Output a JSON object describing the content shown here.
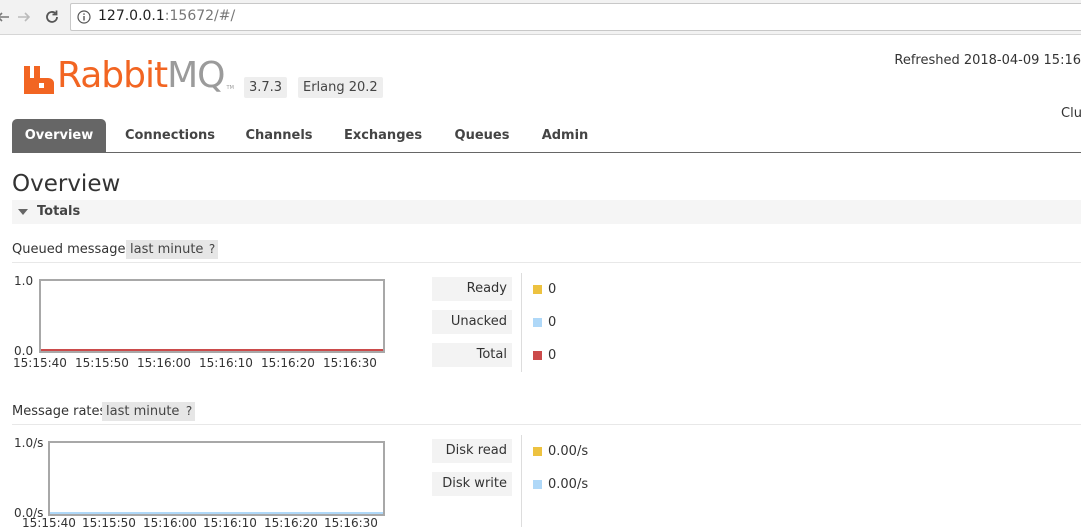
{
  "browser": {
    "url_host": "127.0.0.1",
    "url_rest": ":15672/#/"
  },
  "header": {
    "logo_rabbit": "Rabbit",
    "logo_mq": "MQ",
    "logo_tm": "TM",
    "version": "3.7.3",
    "erlang": "Erlang 20.2",
    "refreshed": "Refreshed 2018-04-09 15:16",
    "cluster": "Clu"
  },
  "tabs": [
    "Overview",
    "Connections",
    "Channels",
    "Exchanges",
    "Queues",
    "Admin"
  ],
  "page": {
    "title": "Overview",
    "section": "Totals",
    "queued": {
      "label": "Queued messages",
      "range": "last minute",
      "help": "?",
      "y_top": "1.0",
      "y_bottom": "0.0",
      "x_ticks": [
        "15:15:40",
        "15:15:50",
        "15:16:00",
        "15:16:10",
        "15:16:20",
        "15:16:30"
      ],
      "legend": [
        {
          "label": "Ready",
          "value": "0",
          "color": "#edc240"
        },
        {
          "label": "Unacked",
          "value": "0",
          "color": "#afd8f8"
        },
        {
          "label": "Total",
          "value": "0",
          "color": "#cb4b4b"
        }
      ]
    },
    "rates": {
      "label": "Message rates",
      "range": "last minute",
      "help": "?",
      "y_top": "1.0/s",
      "y_bottom": "0.0/s",
      "x_ticks": [
        "15:15:40",
        "15:15:50",
        "15:16:00",
        "15:16:10",
        "15:16:20",
        "15:16:30"
      ],
      "legend": [
        {
          "label": "Disk read",
          "value": "0.00/s",
          "color": "#edc240"
        },
        {
          "label": "Disk write",
          "value": "0.00/s",
          "color": "#afd8f8"
        }
      ]
    }
  }
}
